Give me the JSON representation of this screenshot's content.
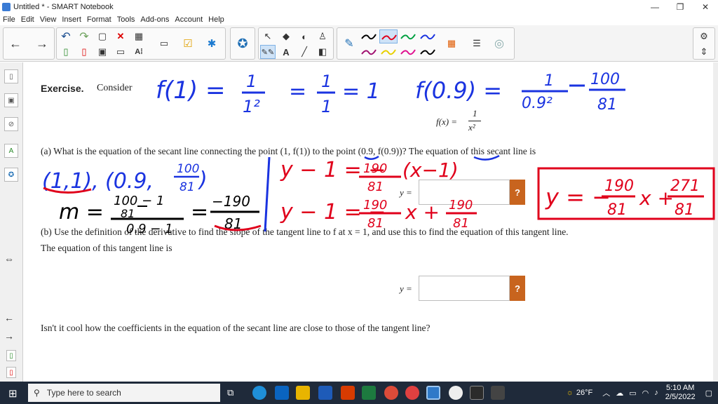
{
  "window": {
    "title": "Untitled * - SMART Notebook",
    "minimize": "—",
    "restore": "❐",
    "close": "✕"
  },
  "menu": [
    "File",
    "Edit",
    "View",
    "Insert",
    "Format",
    "Tools",
    "Add-ons",
    "Account",
    "Help"
  ],
  "toolbar": {
    "back_icon": "←",
    "forward_icon": "→",
    "undo_icon": "↶",
    "redo_icon": "↷",
    "delete_icon": "✕",
    "settings_icon": "⚙",
    "move_icon": "⇕",
    "select_icon": "↖",
    "text_icon": "A",
    "pen_colors": [
      "#000000",
      "#e0001b",
      "#00a040",
      "#1a33e0",
      "#a01070",
      "#e8d000",
      "#e01090",
      "#000000"
    ]
  },
  "page": {
    "exercise_label": "Exercise.",
    "exercise_text": "Consider",
    "function_def": "f(x) = 1/x²",
    "part_a": "(a)  What is the equation of the secant line connecting the point (1, f(1)) to the point (0.9, f(0.9))? The equation of this secant line is",
    "part_b_line1": "(b)  Use the definition of the derivative to find the slope of the tangent line to f at x = 1, and use this to find the equation of this tangent line.",
    "part_b_line2": "The equation of this tangent line is",
    "closing": "Isn't it cool how the coefficients in the equation of the secant line are close to those of the tangent line?",
    "y_label": "y =",
    "help_button": "?"
  },
  "ink": {
    "f1_line": "f(1) = 1/1² = 1/1 = 1",
    "f09_line": "f(0.9) = 1/0.9² = 100/81",
    "point1": "(1,1)",
    "point2": "(0.9, 100/81)",
    "slope": "m = (100/81 − 1)/(0.9 − 1) = −190/81",
    "red_line1": "y − 1 = −190/81 (x − 1)",
    "red_line2": "y − 1 = −190/81 x + 190/81",
    "red_result": "y = −190/81 x + 271/81"
  },
  "taskbar": {
    "search_placeholder": "Type here to search",
    "temperature": "26°F",
    "time": "5:10 AM",
    "date": "2/5/2022"
  }
}
